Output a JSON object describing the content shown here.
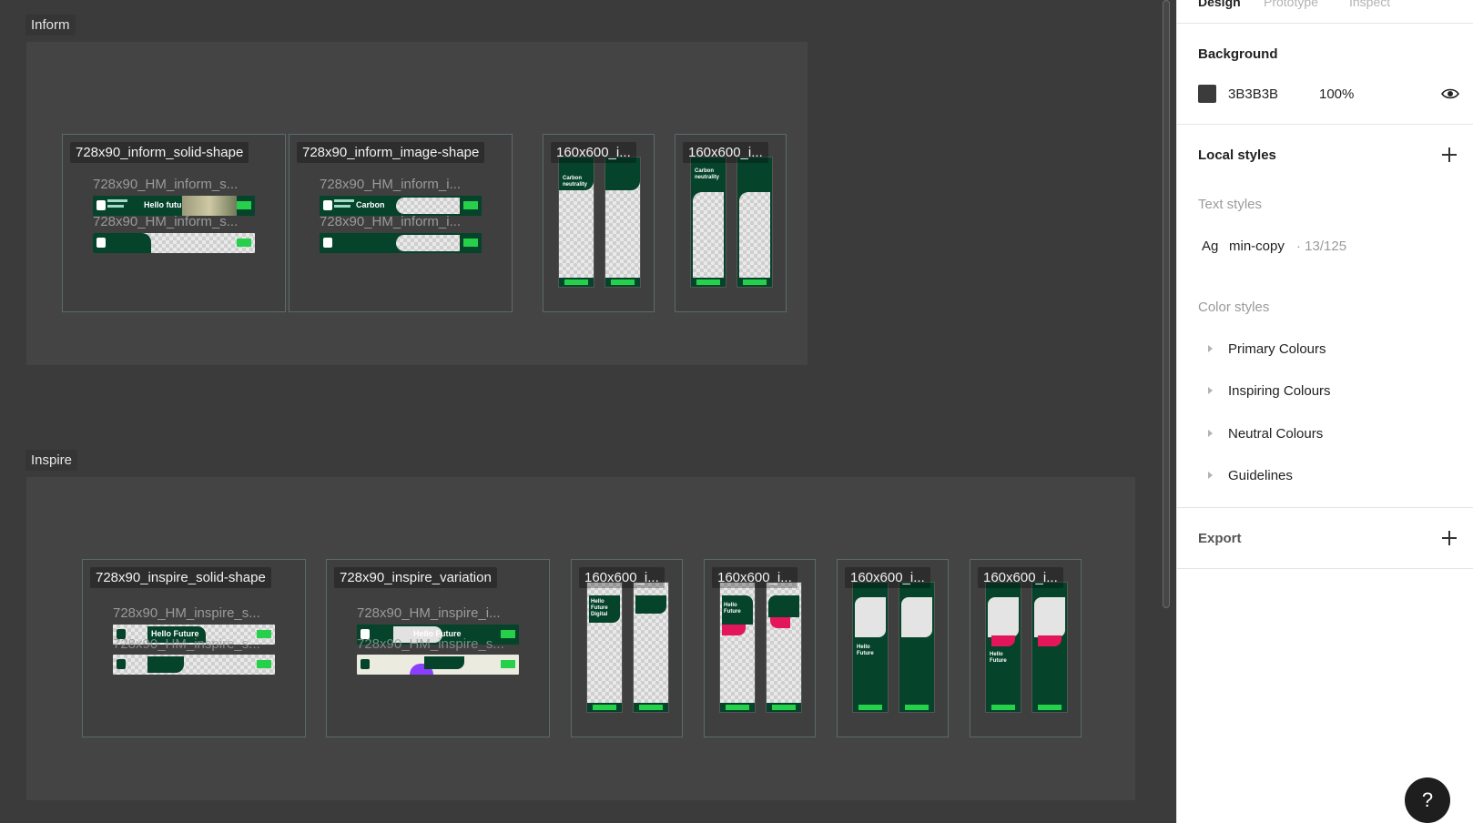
{
  "colors": {
    "canvas_bg": "#3b3b3b",
    "section_bg": "#444444",
    "brand_green": "#05432b",
    "cta_green": "#26d04b",
    "accent_pink": "#e3165b",
    "accent_purple": "#8a3ffc"
  },
  "panel": {
    "tabs": [
      "Design",
      "Prototype",
      "Inspect"
    ],
    "background": {
      "title": "Background",
      "hex": "3B3B3B",
      "opacity": "100%"
    },
    "local_styles": {
      "title": "Local styles",
      "text_styles_label": "Text styles",
      "text_style": {
        "preview": "Ag",
        "name": "min-copy",
        "meta": "· 13/125"
      },
      "color_styles_label": "Color styles",
      "color_groups": [
        "Primary Colours",
        "Inspiring Colours",
        "Neutral Colours",
        "Guidelines"
      ]
    },
    "export": {
      "title": "Export"
    },
    "help": "?"
  },
  "canvas": {
    "inform": {
      "label": "Inform",
      "frames": [
        {
          "label": "728x90_inform_solid-shape",
          "children": [
            "728x90_HM_inform_s...",
            "728x90_HM_inform_s..."
          ],
          "banner_text": "Hello future"
        },
        {
          "label": "728x90_inform_image-shape",
          "children": [
            "728x90_HM_inform_i...",
            "728x90_HM_inform_i..."
          ],
          "banner_text": "Carbon"
        },
        {
          "label": "160x600_i...",
          "sky_text": "Carbon neutrality"
        },
        {
          "label": "160x600_i...",
          "sky_text": "Carbon neutrality"
        }
      ]
    },
    "inspire": {
      "label": "Inspire",
      "frames": [
        {
          "label": "728x90_inspire_solid-shape",
          "children": [
            "728x90_HM_inspire_s...",
            "728x90_HM_inspire_s..."
          ],
          "banner_text": "Hello Future"
        },
        {
          "label": "728x90_inspire_variation",
          "children": [
            "728x90_HM_inspire_i...",
            "728x90_HM_inspire_s..."
          ],
          "banner_text": "Hello Future"
        },
        {
          "label": "160x600_i...",
          "sky_text": "Hello Future Digital"
        },
        {
          "label": "160x600_i...",
          "sky_text": "Hello Future"
        },
        {
          "label": "160x600_i...",
          "sky_text": "Hello Future"
        },
        {
          "label": "160x600_i...",
          "sky_text": "Hello Future"
        }
      ]
    }
  }
}
